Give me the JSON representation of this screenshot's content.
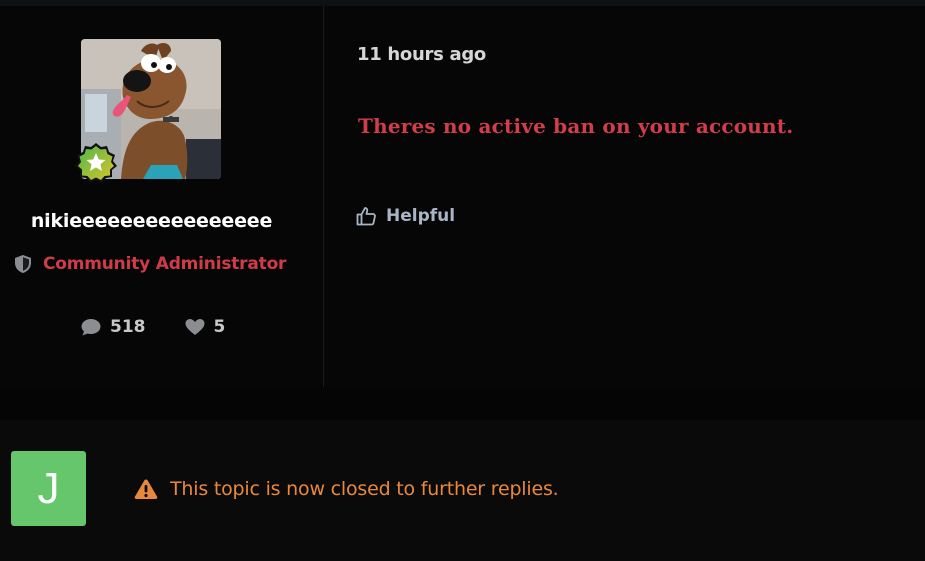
{
  "post": {
    "author": {
      "username": "nikieeeeeeeeeeeeeeee",
      "avatar_icon": "scooby-doo-avatar",
      "rank_icon": "star-rank-badge-icon",
      "role_icon": "shield-icon",
      "role_label": "Community Administrator",
      "role_color": "#d03b48",
      "stats": {
        "posts_icon": "speech-bubble-icon",
        "posts_count": "518",
        "likes_icon": "heart-icon",
        "likes_count": "5"
      }
    },
    "timestamp": "11 hours ago",
    "message": "Theres no active ban on your account.",
    "message_color": "#d13d48",
    "helpful_icon": "thumbs-up-icon",
    "helpful_label": "Helpful"
  },
  "closed_bar": {
    "user_initial": "J",
    "avatar_color": "#65c66b",
    "warning_icon": "warning-triangle-icon",
    "notice_text": "This topic is now closed to further replies.",
    "notice_color": "#e9883b"
  }
}
